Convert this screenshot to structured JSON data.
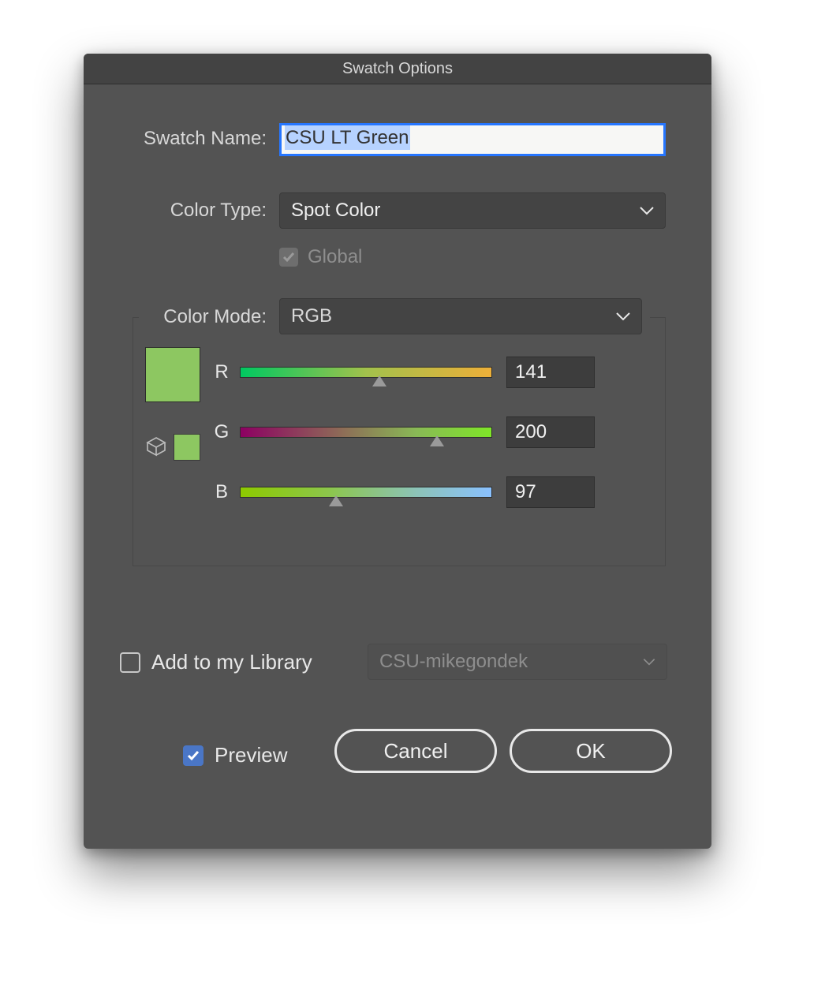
{
  "title": "Swatch Options",
  "labels": {
    "name": "Swatch Name:",
    "type": "Color Type:",
    "global": "Global",
    "mode": "Color Mode:",
    "addLib": "Add to my Library",
    "preview": "Preview"
  },
  "fields": {
    "swatchName": "CSU LT Green",
    "colorType": "Spot Color",
    "globalChecked": true,
    "globalDisabled": true,
    "colorMode": "RGB",
    "library": "CSU-mikegondek",
    "addToLibraryChecked": false,
    "previewChecked": true
  },
  "channels": {
    "r": {
      "label": "R",
      "value": "141",
      "max": 255
    },
    "g": {
      "label": "G",
      "value": "200",
      "max": 255
    },
    "b": {
      "label": "B",
      "value": "97",
      "max": 255
    }
  },
  "swatchColor": "#8dc761",
  "buttons": {
    "cancel": "Cancel",
    "ok": "OK"
  }
}
